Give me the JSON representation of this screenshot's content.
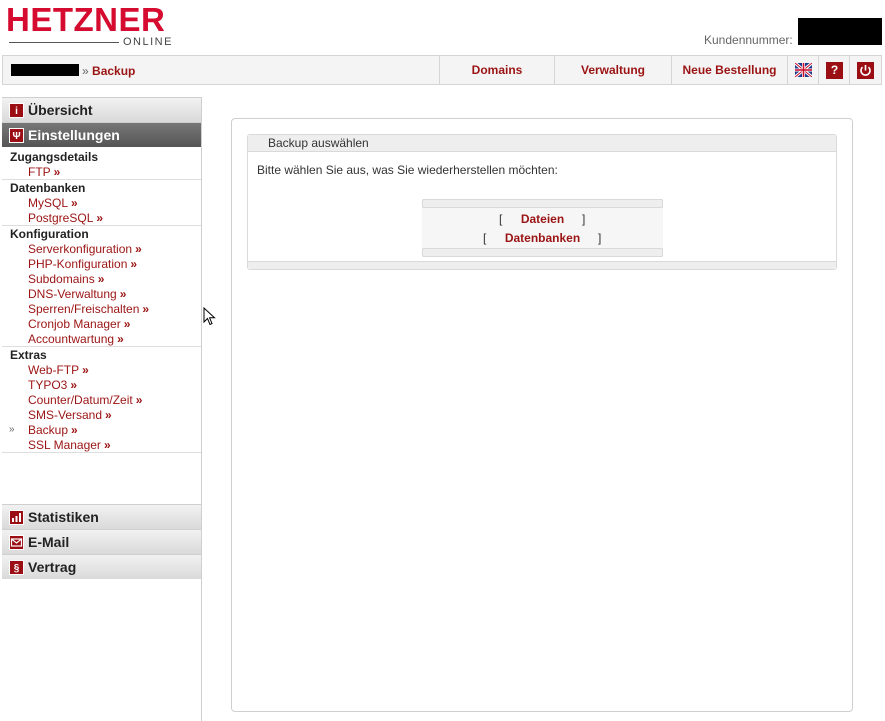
{
  "header": {
    "logo_text": "HETZNER",
    "logo_sub": "ONLINE",
    "customer_label": "Kundennummer:"
  },
  "topnav": {
    "breadcrumb_sep": "»",
    "breadcrumb_current": "Backup",
    "items": [
      "Domains",
      "Verwaltung",
      "Neue Bestellung"
    ],
    "icons": [
      "uk-flag-icon",
      "help-icon",
      "power-icon"
    ],
    "help_glyph": "?"
  },
  "sidebar": {
    "sections": {
      "overview": "Übersicht",
      "settings": "Einstellungen",
      "stats": "Statistiken",
      "email": "E-Mail",
      "contract": "Vertrag"
    },
    "groups": [
      {
        "title": "Zugangsdetails",
        "items": [
          "FTP"
        ]
      },
      {
        "title": "Datenbanken",
        "items": [
          "MySQL",
          "PostgreSQL"
        ]
      },
      {
        "title": "Konfiguration",
        "items": [
          "Serverkonfiguration",
          "PHP-Konfiguration",
          "Subdomains",
          "DNS-Verwaltung",
          "Sperren/Freischalten",
          "Cronjob Manager",
          "Accountwartung"
        ]
      },
      {
        "title": "Extras",
        "items": [
          "Web-FTP",
          "TYPO3",
          "Counter/Datum/Zeit",
          "SMS-Versand",
          "Backup",
          "SSL Manager"
        ]
      }
    ],
    "link_suffix": "»",
    "current_marker": "»",
    "contract_glyph": "§"
  },
  "main": {
    "panel_title": "Backup auswählen",
    "prompt": "Bitte wählen Sie aus, was Sie wiederherstellen möchten:",
    "options": [
      "Dateien",
      "Datenbanken"
    ],
    "bracket_open": "[",
    "bracket_close": "]"
  },
  "colors": {
    "brand": "#d50c2f",
    "link": "#9b1414"
  }
}
